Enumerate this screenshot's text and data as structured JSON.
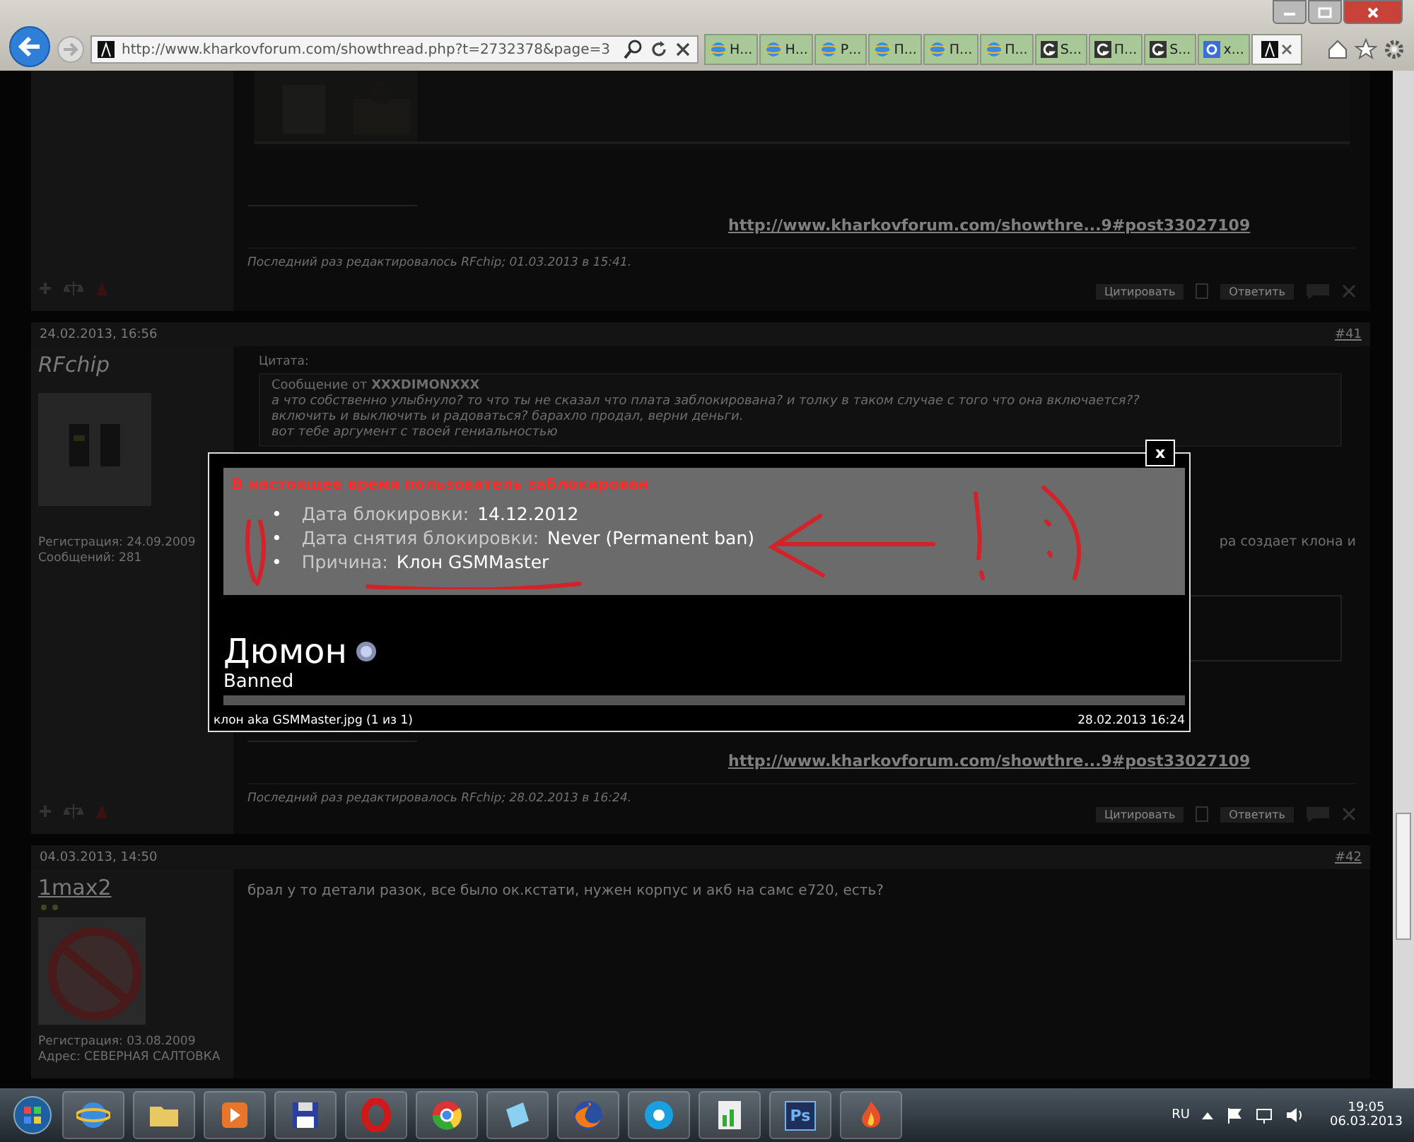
{
  "browser": {
    "url": "http://www.kharkovforum.com/showthread.php?t=2732378&page=3",
    "tabs": [
      {
        "label": "Н...",
        "kind": "ie",
        "selected": false
      },
      {
        "label": "Н...",
        "kind": "ie",
        "selected": false
      },
      {
        "label": "Р...",
        "kind": "ie",
        "selected": false
      },
      {
        "label": "П...",
        "kind": "ie",
        "selected": false
      },
      {
        "label": "П...",
        "kind": "ie",
        "selected": false
      },
      {
        "label": "П...",
        "kind": "ie",
        "selected": false
      },
      {
        "label": "S...",
        "kind": "g",
        "selected": false
      },
      {
        "label": "П...",
        "kind": "g",
        "selected": false
      },
      {
        "label": "S...",
        "kind": "g",
        "selected": false
      },
      {
        "label": "х...",
        "kind": "google",
        "selected": false
      },
      {
        "kind": "forum",
        "selected": true
      }
    ]
  },
  "posts": [
    {
      "kind": "tail",
      "signature_link": "http://www.kharkovforum.com/showthre...9#post33027109",
      "edit_note": "Последний раз редактировалось RFchip; 01.03.2013 в 15:41.",
      "quote_button": "Цитировать",
      "reply_button": "Ответить"
    },
    {
      "kind": "full",
      "date": "24.02.2013, 16:56",
      "number": "#41",
      "author": "RFchip",
      "registered": "Регистрация: 24.09.2009",
      "posts_count": "Сообщений: 281",
      "quote_label": "Цитата:",
      "quote_from": "Сообщение от **XXXDIMONXXX**",
      "quote_lines": [
        "а что собственно улыбнуло? то что ты не сказал что плата заблокирована? и толку в таком случае с того что она включается??",
        "включить и выключить и радоваться? барахло продал, верни деньги.",
        "вот тебе аргумент с твоей гениальностью"
      ],
      "side_text": "ра создает клона и",
      "signature_link": "http://www.kharkovforum.com/showthre...9#post33027109",
      "edit_note": "Последний раз редактировалось RFchip; 28.02.2013 в 16:24.",
      "quote_button": "Цитировать",
      "reply_button": "Ответить"
    },
    {
      "kind": "open",
      "date": "04.03.2013, 14:50",
      "number": "#42",
      "author": "1max2",
      "registered": "Регистрация: 03.08.2009",
      "address": "Адрес: СЕВЕРНАЯ САЛТОВКА",
      "message": "брал у то детали разок, все было ок.кстати, нужен корпус и акб на самс е720, есть?"
    }
  ],
  "lightbox": {
    "close": "x",
    "banner": "В настоящее время пользователь заблокирован",
    "facts": [
      {
        "bullet": "•",
        "label": "Дата блокировки:",
        "value": "14.12.2012"
      },
      {
        "bullet": "•",
        "label": "Дата снятия блокировки:",
        "value": "Never (Permanent ban)"
      },
      {
        "bullet": "•",
        "label": "Причина:",
        "value": "Клон GSMMaster"
      }
    ],
    "username": "Дюмон",
    "status": "Banned",
    "caption": "клон aka GSMMaster.jpg (1 из 1)",
    "timestamp": "28.02.2013 16:24"
  },
  "taskbar": {
    "ps_label": "Ps",
    "language": "RU",
    "time": "19:05",
    "date": "06.03.2013"
  }
}
